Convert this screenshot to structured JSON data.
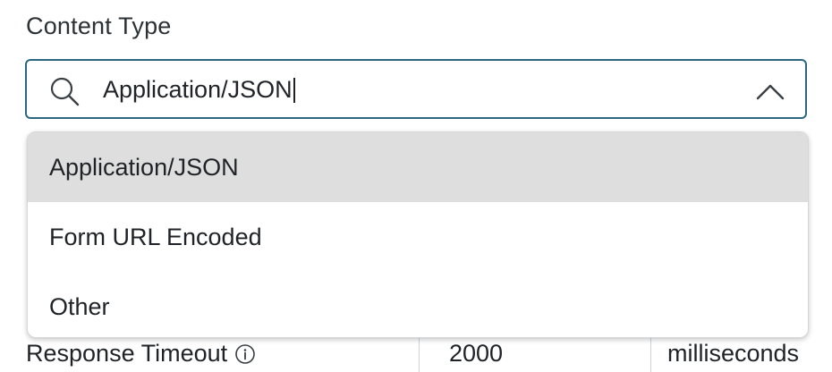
{
  "field": {
    "label": "Content Type",
    "value": "Application/JSON",
    "expanded": true
  },
  "dropdown": {
    "options": [
      {
        "label": "Application/JSON",
        "highlighted": true
      },
      {
        "label": "Form URL Encoded",
        "highlighted": false
      },
      {
        "label": "Other",
        "highlighted": false
      }
    ]
  },
  "response_timeout": {
    "label": "Response Timeout",
    "value": "2000",
    "unit": "milliseconds",
    "info_icon": "info-icon"
  },
  "colors": {
    "focus_border": "#2b6880",
    "highlight_bg": "#dedede",
    "text": "#1f2327"
  },
  "icons": {
    "search": "search-icon",
    "collapse": "chevron-up-icon"
  }
}
